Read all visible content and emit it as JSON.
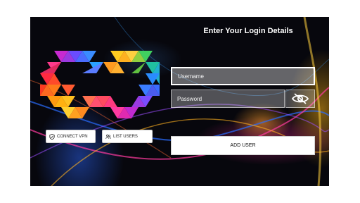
{
  "login": {
    "title": "Enter Your Login Details",
    "username_placeholder": "Username",
    "password_placeholder": "Password",
    "add_user_label": "ADD USER"
  },
  "actions": {
    "connect_vpn_label": "CONNECT VPN",
    "list_users_label": "LIST USERS"
  },
  "icons": {
    "vpn": "shield-check-icon",
    "list_users": "users-icon",
    "password_toggle": "eye-off-icon"
  },
  "colors": {
    "background": "#07070d",
    "field_border": "#ffffff"
  }
}
